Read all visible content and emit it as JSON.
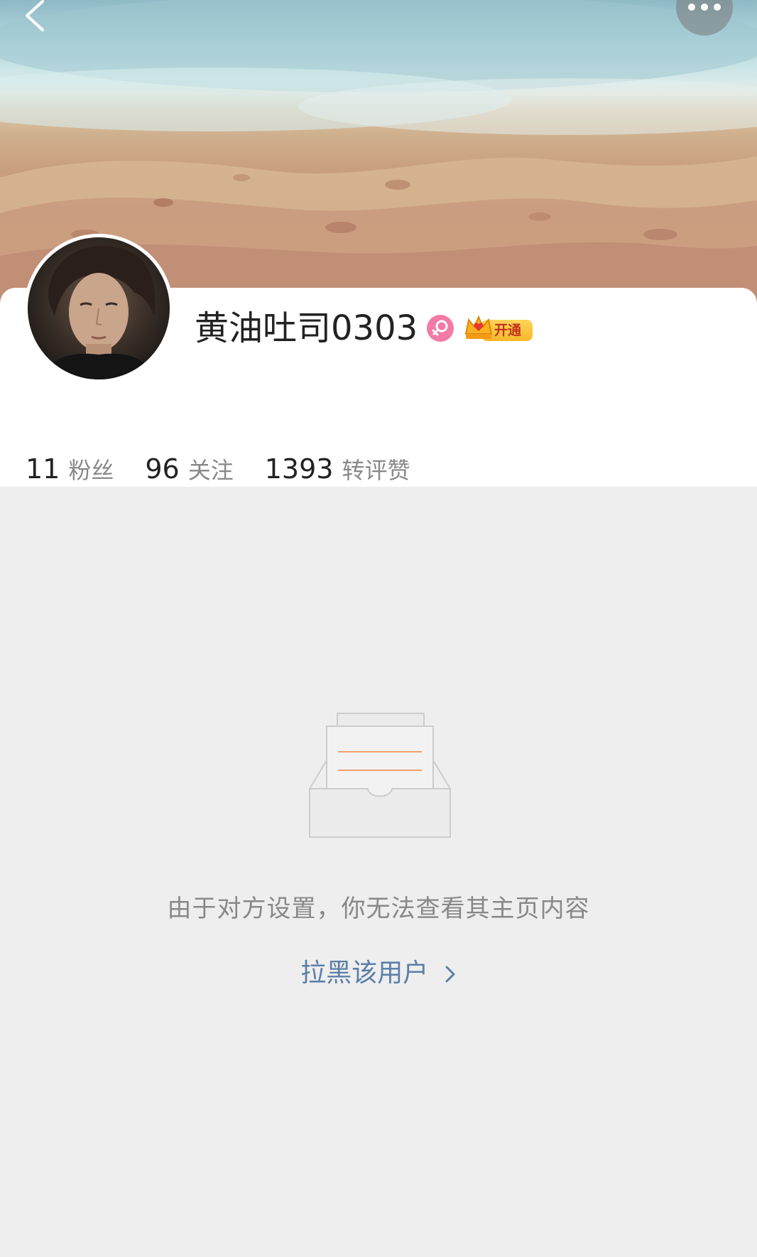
{
  "header": {
    "back_icon": "chevron-left-icon",
    "more_icon": "more-horizontal-icon"
  },
  "profile": {
    "username": "黄油吐司0303",
    "gender_icon": "female-icon",
    "vip_icon": "crown-icon",
    "vip_label": "开通",
    "stats": [
      {
        "value": "11",
        "label": "粉丝"
      },
      {
        "value": "96",
        "label": "关注"
      },
      {
        "value": "1393",
        "label": "转评赞"
      }
    ]
  },
  "empty_state": {
    "icon": "empty-inbox-icon",
    "message": "由于对方设置，你无法查看其主页内容",
    "action_label": "拉黑该用户",
    "action_icon": "chevron-right-icon"
  },
  "colors": {
    "background": "#eeeeee",
    "card": "#ffffff",
    "link": "#5b7fa8",
    "gender_badge": "#f27aa6",
    "vip_gold": "#f7b82a",
    "illustration_accent": "#f0a070"
  }
}
